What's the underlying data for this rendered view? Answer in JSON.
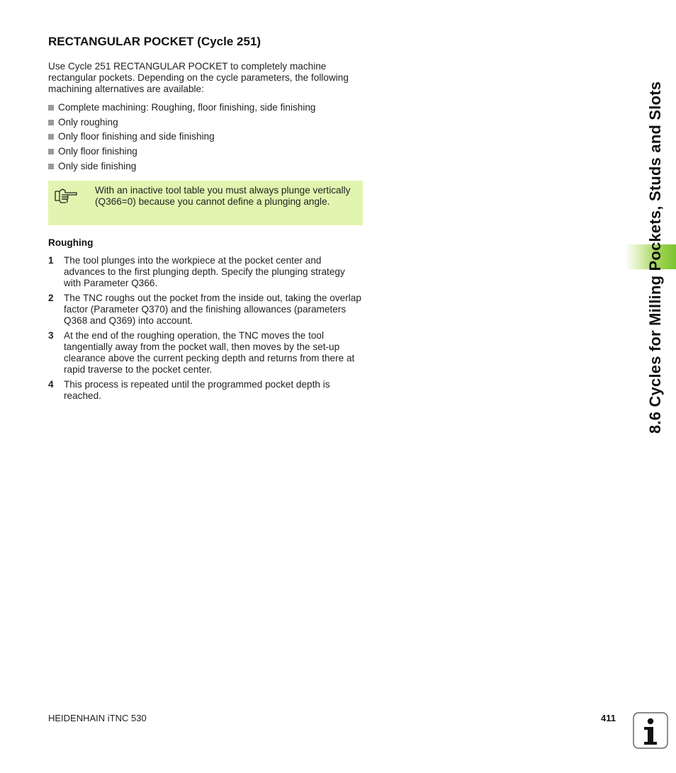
{
  "title": "RECTANGULAR POCKET (Cycle 251)",
  "intro": "Use Cycle 251 RECTANGULAR POCKET to completely machine rectangular pockets. Depending on the cycle parameters, the following machining alternatives are available:",
  "bullets": [
    "Complete machining: Roughing, floor finishing, side finishing",
    "Only roughing",
    "Only floor finishing and side finishing",
    "Only floor finishing",
    "Only side finishing"
  ],
  "note": {
    "icon": "pointing-hand-icon",
    "text": "With an inactive tool table you must always plunge vertically (Q366=0) because you cannot define a plunging angle.",
    "background": "#e1f5b0"
  },
  "subheading": "Roughing",
  "steps": [
    {
      "num": "1",
      "text": "The tool plunges into the workpiece at the pocket center and advances to the first plunging depth. Specify the plunging strategy with Parameter Q366."
    },
    {
      "num": "2",
      "text": "The TNC roughs out the pocket from the inside out, taking the overlap factor (Parameter Q370) and the finishing allowances (parameters Q368 and Q369) into account."
    },
    {
      "num": "3",
      "text": "At the end of the roughing operation, the TNC moves the tool tangentially away from the pocket wall, then moves by the set-up clearance above the current pecking depth and returns from there at rapid traverse to the pocket center."
    },
    {
      "num": "4",
      "text": "This process is repeated until the programmed pocket depth is reached."
    }
  ],
  "side_tab": {
    "text": "8.6 Cycles for Milling Pockets, Studs and Slots",
    "accent": "#7cc22e"
  },
  "footer": {
    "left": "HEIDENHAIN iTNC 530",
    "page": "411",
    "icon": "info-icon"
  }
}
